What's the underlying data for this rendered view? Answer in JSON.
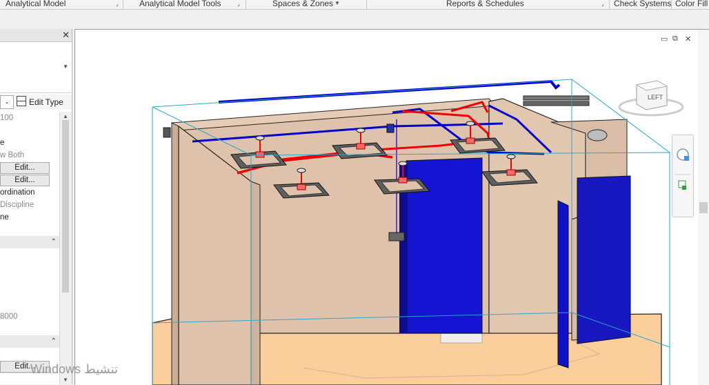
{
  "ribbon": {
    "tabs": [
      {
        "label": "Analytical Model"
      },
      {
        "label": "Analytical Model Tools"
      },
      {
        "label": "Spaces & Zones"
      },
      {
        "label": "Reports & Schedules"
      },
      {
        "label": "Check Systems"
      },
      {
        "label": "Color Fill"
      }
    ]
  },
  "properties": {
    "close_glyph": "✕",
    "edit_type_label": "Edit Type",
    "rows": [
      {
        "text": "100",
        "kind": "gray"
      },
      {
        "text": "",
        "kind": "plain"
      },
      {
        "text": "e",
        "kind": "plain"
      },
      {
        "text": "w Both",
        "kind": "gray"
      },
      {
        "text": "Edit...",
        "kind": "button"
      },
      {
        "text": "Edit...",
        "kind": "button"
      },
      {
        "text": "ordination",
        "kind": "plain"
      },
      {
        "text": "Discipline",
        "kind": "gray"
      },
      {
        "text": "ne",
        "kind": "plain"
      },
      {
        "text": "",
        "kind": "plain"
      },
      {
        "text": "",
        "kind": "category"
      },
      {
        "text": "",
        "kind": "plain"
      },
      {
        "text": "",
        "kind": "plain"
      },
      {
        "text": "",
        "kind": "plain"
      },
      {
        "text": "",
        "kind": "plain"
      },
      {
        "text": "",
        "kind": "plain"
      },
      {
        "text": "8000",
        "kind": "gray"
      },
      {
        "text": "",
        "kind": "plain"
      },
      {
        "text": "",
        "kind": "category"
      },
      {
        "text": "",
        "kind": "plain"
      },
      {
        "text": "Edit...",
        "kind": "button"
      }
    ]
  },
  "viewport": {
    "view_cube_label": "LEFT",
    "window_controls": [
      "▭",
      "⧉",
      "✕"
    ]
  },
  "watermark": {
    "text": "Windows تنشيط"
  },
  "colors": {
    "wall": "#dfc2ab",
    "floor": "#fbcf9c",
    "supply_duct": "#ee0000",
    "return_duct": "#0000cc",
    "door": "#1010c8",
    "diffuser": "#6f6f6f"
  }
}
